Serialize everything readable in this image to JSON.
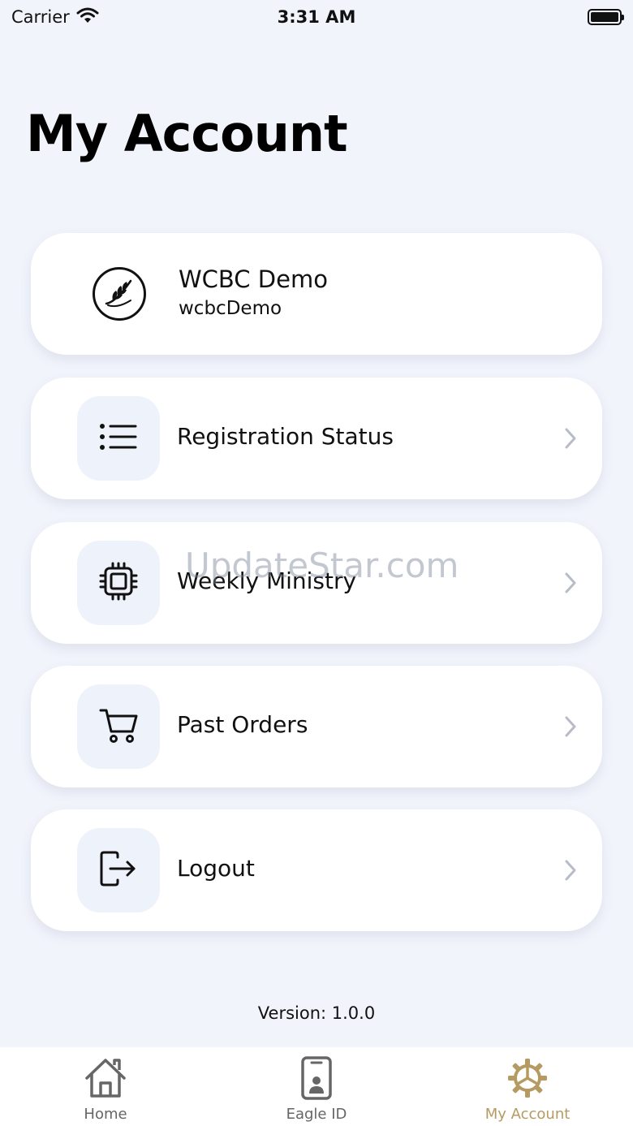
{
  "status_bar": {
    "carrier": "Carrier",
    "time": "3:31 AM"
  },
  "page": {
    "title": "My Account"
  },
  "profile": {
    "name": "WCBC Demo",
    "username": "wcbcDemo"
  },
  "menu": [
    {
      "label": "Registration Status",
      "icon": "list-icon"
    },
    {
      "label": "Weekly Ministry",
      "icon": "chip-icon"
    },
    {
      "label": "Past Orders",
      "icon": "cart-icon"
    },
    {
      "label": "Logout",
      "icon": "logout-icon"
    }
  ],
  "watermark": "UpdateStar.com",
  "version": "Version: 1.0.0",
  "tabs": [
    {
      "label": "Home",
      "icon": "home-icon",
      "active": false
    },
    {
      "label": "Eagle ID",
      "icon": "id-card-icon",
      "active": false
    },
    {
      "label": "My Account",
      "icon": "gear-icon",
      "active": true
    }
  ],
  "colors": {
    "background": "#f1f4fb",
    "active_tab": "#b59b62",
    "inactive_tab": "#666666"
  }
}
